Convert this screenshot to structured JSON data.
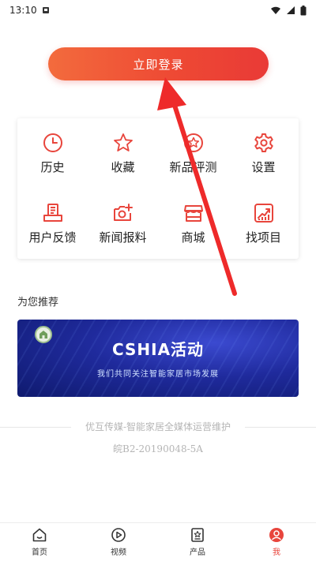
{
  "status_bar": {
    "time": "13:10"
  },
  "login": {
    "label": "立即登录"
  },
  "menu": {
    "items": [
      {
        "label": "历史",
        "icon": "clock-icon"
      },
      {
        "label": "收藏",
        "icon": "star-icon"
      },
      {
        "label": "新品评测",
        "icon": "badge-star-icon"
      },
      {
        "label": "设置",
        "icon": "gear-icon"
      },
      {
        "label": "用户反馈",
        "icon": "feedback-icon"
      },
      {
        "label": "新闻报料",
        "icon": "camera-plus-icon"
      },
      {
        "label": "商城",
        "icon": "shop-icon"
      },
      {
        "label": "找项目",
        "icon": "chart-icon"
      }
    ]
  },
  "recommend": {
    "title": "为您推荐",
    "banner_title": "CSHIA活动",
    "banner_subtitle": "我们共同关注智能家居市场发展"
  },
  "footer": {
    "line1": "优互传媒-智能家居全媒体运营维护",
    "line2": "皖B2-20190048-5A"
  },
  "tabs": [
    {
      "label": "首页",
      "icon": "home-icon",
      "active": false
    },
    {
      "label": "视频",
      "icon": "play-icon",
      "active": false
    },
    {
      "label": "产品",
      "icon": "product-icon",
      "active": false
    },
    {
      "label": "我",
      "icon": "user-icon",
      "active": true
    }
  ],
  "colors": {
    "accent": "#e8453c",
    "annotation_arrow": "#ee2a2a"
  }
}
